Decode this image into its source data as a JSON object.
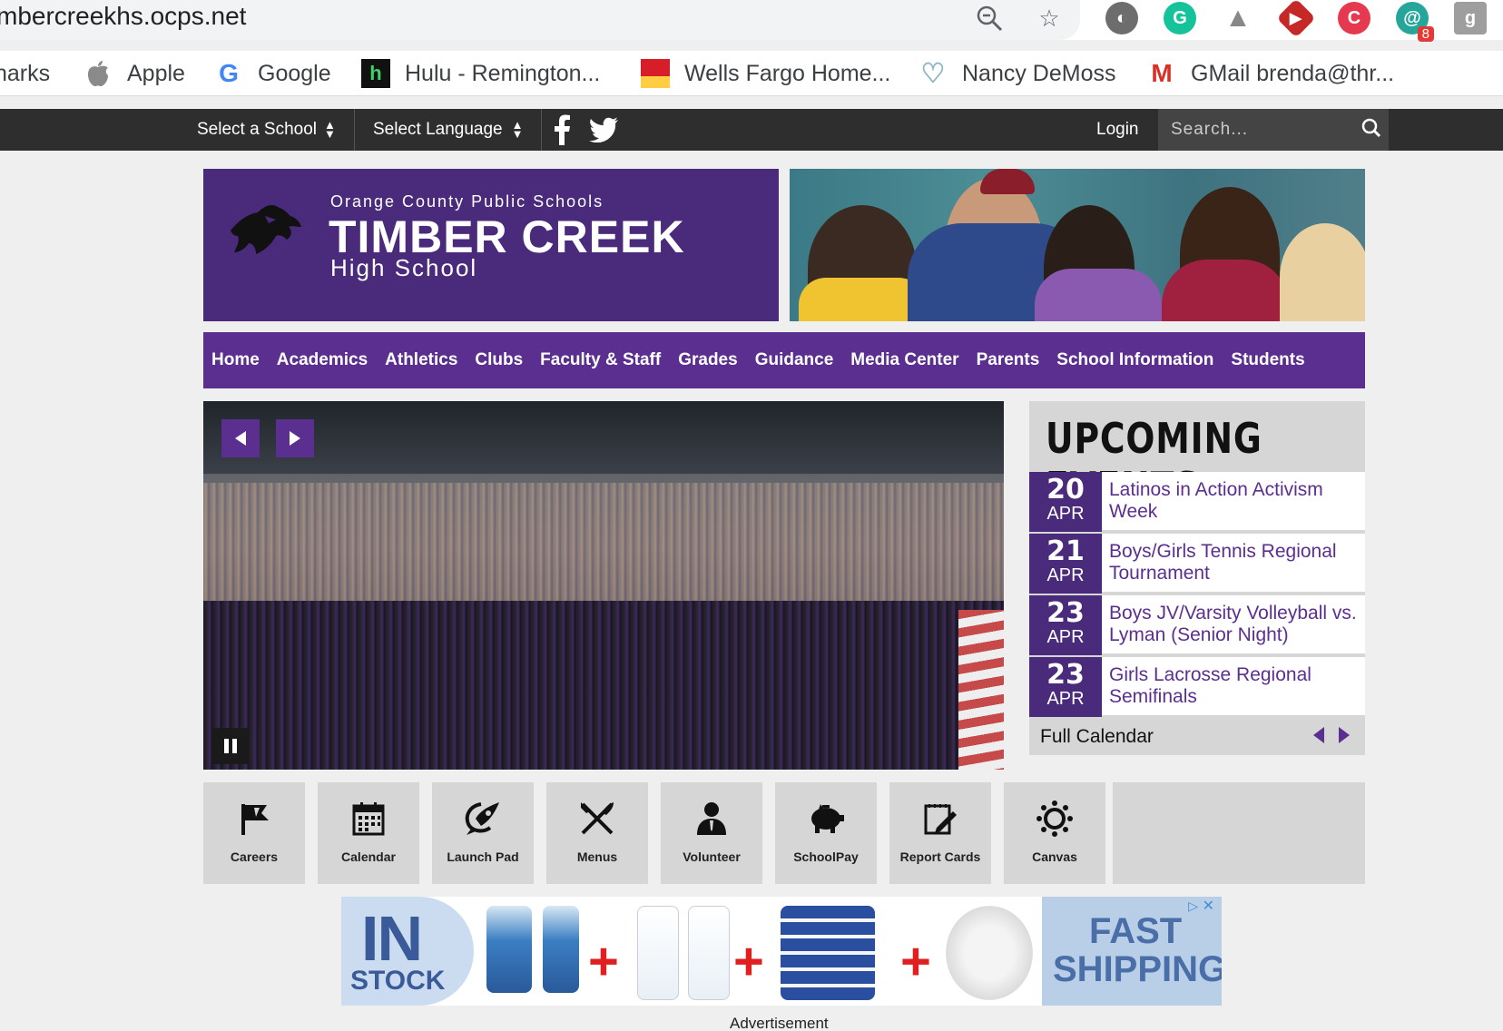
{
  "browser": {
    "url": "timbercreekhs.ocps.net",
    "extensions": [
      {
        "name": "extension-gray-circle",
        "color": "#6d6d6d",
        "glyph": "◐"
      },
      {
        "name": "grammarly",
        "color": "#15c39a",
        "glyph": "G"
      },
      {
        "name": "google-drive",
        "color": "#888888",
        "glyph": "▲"
      },
      {
        "name": "play-extension",
        "color": "#c62828",
        "glyph": "▶"
      },
      {
        "name": "red-c-extension",
        "color": "#e53950",
        "glyph": "C"
      },
      {
        "name": "at-extension",
        "color": "#26a69a",
        "glyph": "@",
        "badge": "8"
      },
      {
        "name": "g-extension",
        "color": "#9e9e9e",
        "glyph": "g"
      }
    ]
  },
  "bookmarks": [
    {
      "label": "narks",
      "icon": ""
    },
    {
      "label": "Apple",
      "icon": "apple-icon"
    },
    {
      "label": "Google",
      "icon": "google-icon"
    },
    {
      "label": "Hulu - Remington...",
      "icon": "hulu-icon"
    },
    {
      "label": "Wells Fargo Home...",
      "icon": "wells-fargo-icon"
    },
    {
      "label": "Nancy DeMoss",
      "icon": "heart-icon"
    },
    {
      "label": "GMail brenda@thr...",
      "icon": "gmail-icon"
    }
  ],
  "topbar": {
    "select_school": "Select a School",
    "select_language": "Select Language",
    "login": "Login",
    "search_placeholder": "Search..."
  },
  "header": {
    "district": "Orange County Public Schools",
    "school_name": "TIMBER CREEK",
    "school_type": "High School"
  },
  "nav": [
    "Home",
    "Academics",
    "Athletics",
    "Clubs",
    "Faculty & Staff",
    "Grades",
    "Guidance",
    "Media Center",
    "Parents",
    "School Information",
    "Students"
  ],
  "events": {
    "title": "UPCOMING EVENTS",
    "items": [
      {
        "day": "20",
        "month": "APR",
        "name": "Latinos in Action Activism Week"
      },
      {
        "day": "21",
        "month": "APR",
        "name": "Boys/Girls Tennis Regional Tournament"
      },
      {
        "day": "23",
        "month": "APR",
        "name": "Boys JV/Varsity Volleyball vs. Lyman (Senior Night)"
      },
      {
        "day": "23",
        "month": "APR",
        "name": "Girls Lacrosse Regional Semifinals"
      }
    ],
    "full_calendar": "Full Calendar"
  },
  "quick_links": [
    {
      "label": "Careers",
      "icon": "flag-icon"
    },
    {
      "label": "Calendar",
      "icon": "calendar-icon"
    },
    {
      "label": "Launch Pad",
      "icon": "launch-pad-icon"
    },
    {
      "label": "Menus",
      "icon": "utensils-icon"
    },
    {
      "label": "Volunteer",
      "icon": "volunteer-icon"
    },
    {
      "label": "SchoolPay",
      "icon": "piggy-bank-icon"
    },
    {
      "label": "Report Cards",
      "icon": "report-card-icon"
    },
    {
      "label": "Canvas",
      "icon": "canvas-icon"
    }
  ],
  "ad": {
    "in": "IN",
    "stock": "STOCK",
    "fast": "FAST",
    "shipping": "SHIPPING",
    "caption": "Advertisement"
  },
  "colors": {
    "brand_purple": "#5b2f8f",
    "dark_purple": "#4a2a7a",
    "topbar": "#2e2e2e"
  }
}
